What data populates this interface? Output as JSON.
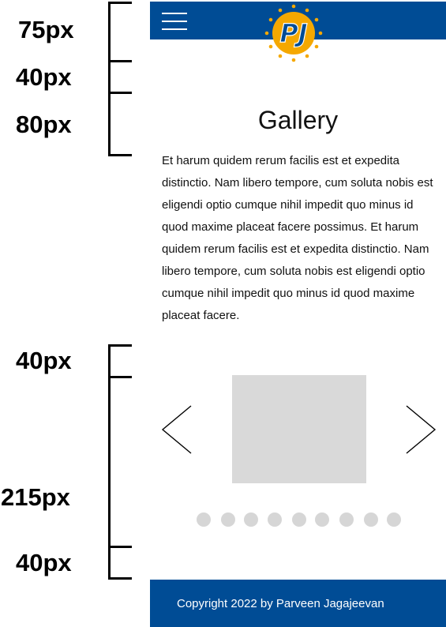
{
  "annotations": {
    "labels": [
      "75px",
      "40px",
      "80px",
      "40px",
      "215px",
      "40px"
    ]
  },
  "header": {
    "menu_icon": "hamburger-menu-icon",
    "logo": {
      "text": "PJ",
      "icon": "pj-logo-icon",
      "colors": {
        "ring": "#f5a800",
        "letters": "#004c95"
      }
    },
    "background": "#004c95"
  },
  "main": {
    "title": "Gallery",
    "body": "Et harum quidem rerum facilis est et expedita distinctio. Nam libero tempore, cum soluta nobis est eligendi optio cumque nihil impedit quo minus id quod maxime placeat facere possimus. Et harum quidem rerum facilis est et expedita distinctio. Nam libero tempore, cum soluta nobis est eligendi optio cumque nihil impedit quo minus id quod maxime placeat facere."
  },
  "carousel": {
    "prev_icon": "chevron-left-icon",
    "next_icon": "chevron-right-icon",
    "image_placeholder_color": "#d9d9d9",
    "dot_count": 9,
    "dot_color": "#d6d6d6"
  },
  "footer": {
    "text": "Copyright 2022 by Parveen Jagajeevan",
    "background": "#004c95"
  }
}
